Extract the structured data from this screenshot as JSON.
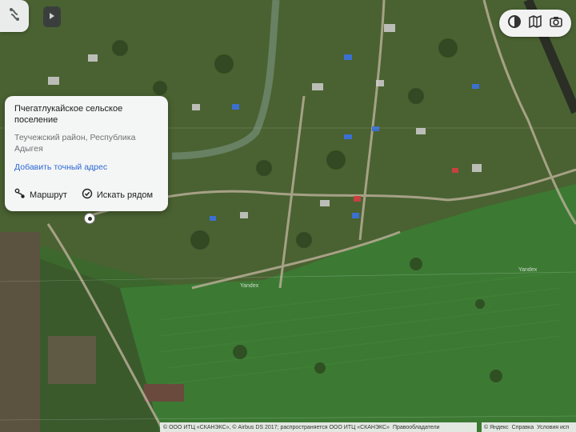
{
  "card": {
    "title": "Пчегатлукайское сельское поселение",
    "region": "Теучежский район, Республика Адыгея",
    "add_address_link": "Добавить точный адрес",
    "route_label": "Маршрут",
    "search_nearby_label": "Искать рядом"
  },
  "map": {
    "labels": {
      "road_label_1": "Yandex",
      "road_label_2": "Yandex"
    }
  },
  "attribution": {
    "text": "© ООО ИТЦ «СКАНЭКС», © Airbus DS 2017; распространяется ООО ИТЦ «СКАНЭКС»",
    "rights_link": "Правообладатели",
    "yandex": "© Яндекс",
    "help_link": "Справка",
    "terms_link": "Условия исп"
  },
  "icons": {
    "top_left": "layers-icon",
    "toggle": "play-arrow-icon",
    "toolbar": [
      "circle-icon",
      "map-icon",
      "camera-icon"
    ],
    "route": "route-icon",
    "search_nearby": "search-nearby-icon"
  },
  "colors": {
    "link": "#2c69d6",
    "card_bg": "#f4f5f5"
  }
}
